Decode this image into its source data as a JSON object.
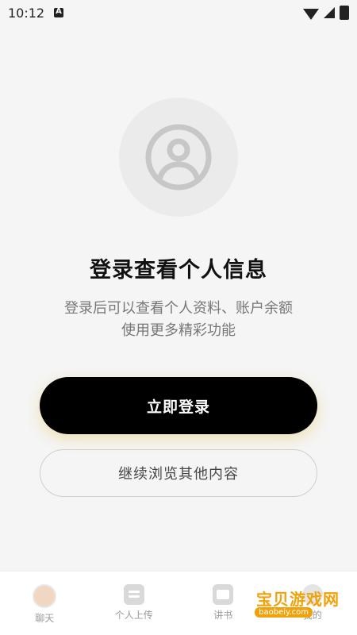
{
  "status_bar": {
    "time": "10:12",
    "left_icon": "a-icon",
    "right_icons": [
      "wifi-icon",
      "signal-icon",
      "battery-icon"
    ]
  },
  "hero": {
    "avatar_icon": "user-avatar-icon",
    "title": "登录查看个人信息",
    "subtitle_line1": "登录后可以查看个人资料、账户余额",
    "subtitle_line2": "使用更多精彩功能"
  },
  "actions": {
    "login_label": "立即登录",
    "browse_label": "继续浏览其他内容"
  },
  "bottom_nav": {
    "items": [
      {
        "label": "聊天",
        "icon": "chat-avatar-icon"
      },
      {
        "label": "个人上传",
        "icon": "upload-doc-icon"
      },
      {
        "label": "讲书",
        "icon": "book-icon"
      },
      {
        "label": "我的",
        "icon": "profile-icon"
      }
    ]
  },
  "watermark": {
    "text": "宝贝游戏网",
    "sub": "baobeiy.com"
  },
  "colors": {
    "background": "#f5f5f5",
    "primary_button": "#000000",
    "watermark": "#f0a20b"
  }
}
